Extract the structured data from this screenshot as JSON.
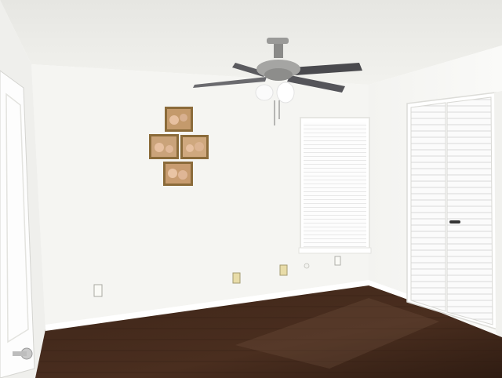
{
  "scene": {
    "description_objects": [
      "ceiling-fan",
      "framed-pictures",
      "window-with-blinds",
      "louvered-closet-doors",
      "room-door",
      "hardwood-floor",
      "wall-outlets"
    ]
  },
  "colors": {
    "wall": "#f6f6f3",
    "wall_shadow": "#ebebe7",
    "ceiling": "#eeeeea",
    "floor": "#3a2418",
    "floor_light": "#5a3a28",
    "trim": "#ffffff",
    "fan_metal": "#8a8a88",
    "fan_blade": "#4a4a4e",
    "frame": "#8b6b3a"
  }
}
